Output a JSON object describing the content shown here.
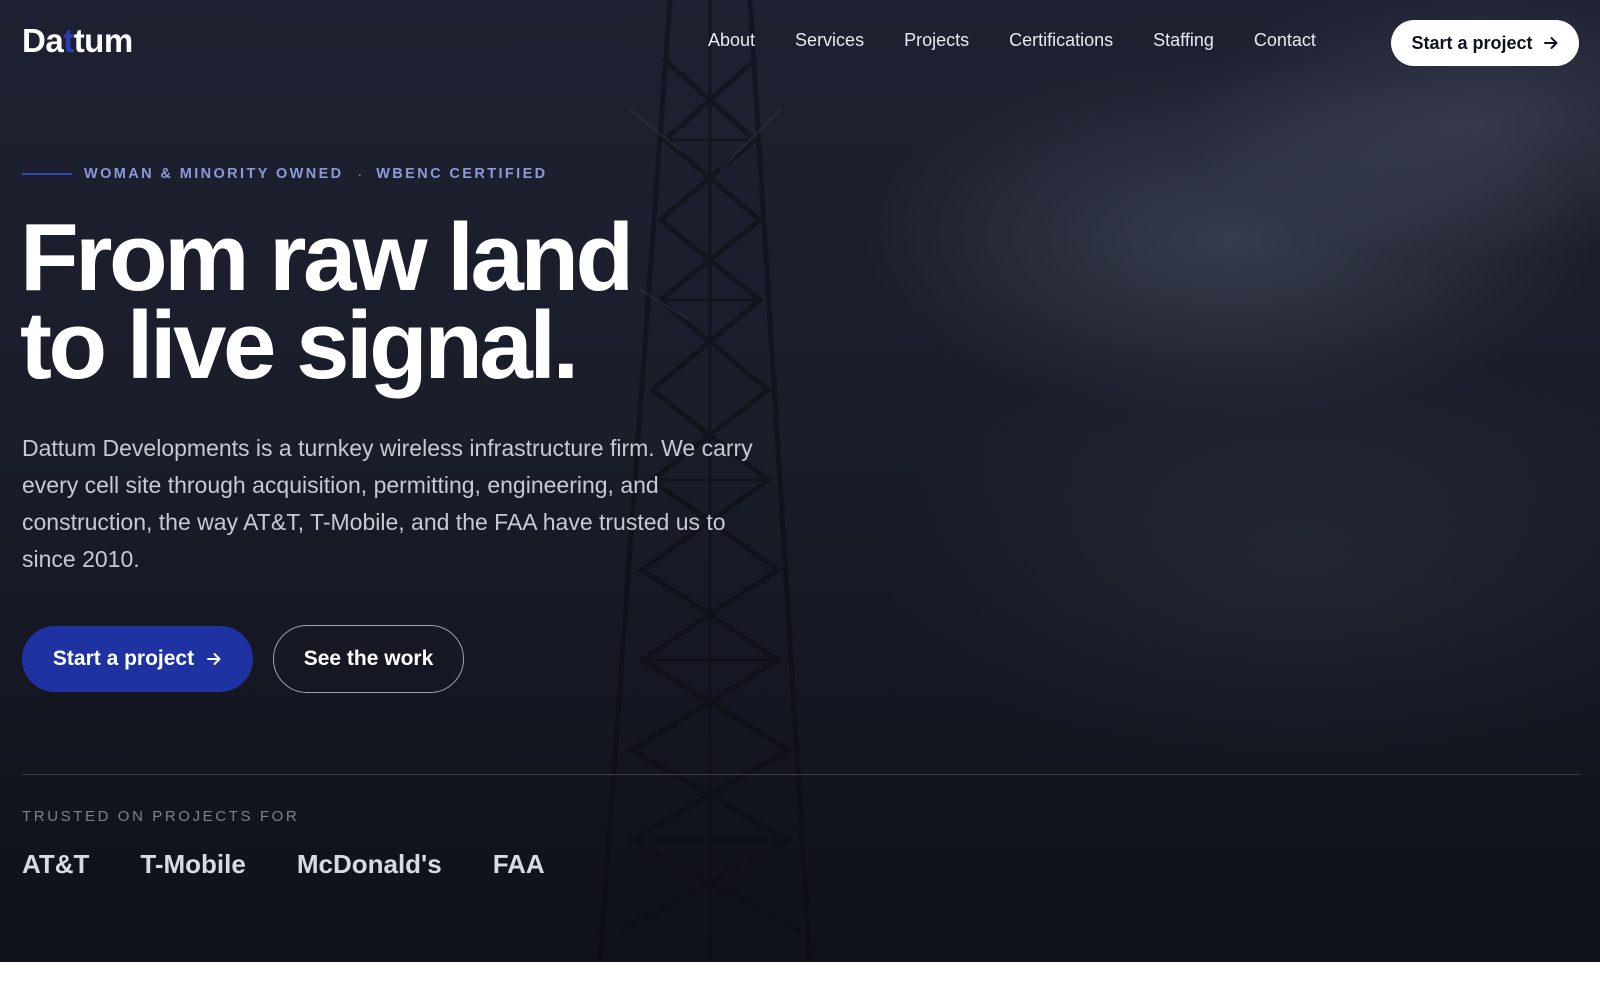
{
  "brand": {
    "logo_text_before": "Da",
    "logo_text_accent": "t",
    "logo_text_after": "tum",
    "accent_color": "#1e33a1"
  },
  "nav": {
    "links": [
      "About",
      "Services",
      "Projects",
      "Certifications",
      "Staffing",
      "Contact"
    ],
    "cta_label": "Start a project",
    "cta_icon": "arrow-right-icon"
  },
  "hero": {
    "eyebrow_left": "WOMAN & MINORITY OWNED",
    "eyebrow_separator": "·",
    "eyebrow_right": "WBENC CERTIFIED",
    "headline_line1": "From raw land",
    "headline_line2": "to live signal.",
    "lead": "Dattum Developments is a turnkey wireless infrastructure firm. We carry every cell site through acquisition, permitting, engineering, and construction, the way AT&T, T-Mobile, and the FAA have trusted us to since 2010.",
    "primary_button": "Start a project",
    "secondary_button": "See the work"
  },
  "trusted": {
    "label": "TRUSTED ON PROJECTS FOR",
    "clients": [
      "AT&T",
      "T-Mobile",
      "McDonald's",
      "FAA"
    ]
  }
}
